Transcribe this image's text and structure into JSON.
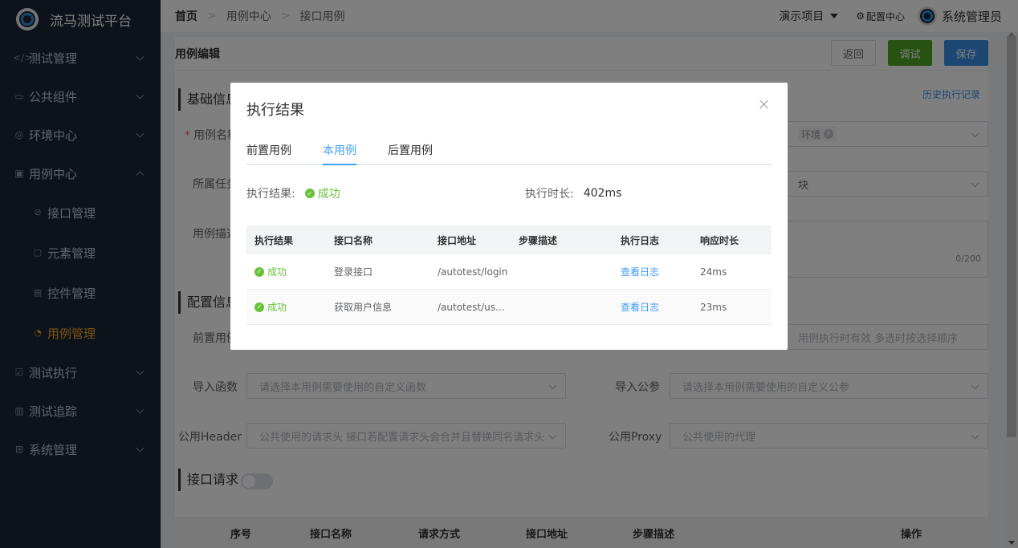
{
  "app": {
    "title": "流马测试平台"
  },
  "sidebar": {
    "items": [
      {
        "label": "测试管理",
        "icon": "code-icon"
      },
      {
        "label": "公共组件",
        "icon": "component-icon"
      },
      {
        "label": "环境中心",
        "icon": "globe-icon"
      },
      {
        "label": "用例中心",
        "icon": "case-icon"
      },
      {
        "label": "测试执行",
        "icon": "checkbox-icon"
      },
      {
        "label": "测试追踪",
        "icon": "chart-icon"
      },
      {
        "label": "系统管理",
        "icon": "grid-icon"
      }
    ],
    "sub_items": [
      {
        "label": "接口管理",
        "icon": "compass-icon"
      },
      {
        "label": "元素管理",
        "icon": "calendar-icon"
      },
      {
        "label": "控件管理",
        "icon": "widget-icon"
      },
      {
        "label": "用例管理",
        "icon": "gauge-icon"
      }
    ]
  },
  "topbar": {
    "breadcrumb": [
      "首页",
      "用例中心",
      "接口用例"
    ],
    "project": "演示项目",
    "config": "配置中心",
    "user": "系统管理员"
  },
  "page": {
    "title": "用例编辑",
    "back": "返回",
    "debug": "调试",
    "save": "保存",
    "history": "历史执行记录",
    "section_basic": "基础信息",
    "label_name": "用例名称",
    "label_module": "所属任务",
    "label_desc": "用例描述",
    "desc_count": "0/200",
    "env_tag": "环境",
    "module_tail": "块",
    "section_config": "配置信息",
    "label_pre": "前置用例",
    "pre_placeholder_tail": "用例执行时有效 多选时按选择顺序",
    "label_func": "导入函数",
    "func_placeholder": "请选择本用例需要使用的自定义函数",
    "label_param": "导入公参",
    "param_placeholder": "请选择本用例需要使用的自定义公参",
    "label_header": "公用Header",
    "header_placeholder": "公共使用的请求头 接口若配置请求头会合并且替换同名请求头",
    "label_proxy": "公用Proxy",
    "proxy_placeholder": "公共使用的代理",
    "section_request": "接口请求",
    "request_columns": [
      "序号",
      "接口名称",
      "请求方式",
      "接口地址",
      "步骤描述",
      "操作"
    ]
  },
  "modal": {
    "title": "执行结果",
    "tabs": [
      "前置用例",
      "本用例",
      "后置用例"
    ],
    "active_tab": 1,
    "result_label": "执行结果:",
    "result_value": "成功",
    "duration_label": "执行时长:",
    "duration_value": "402ms",
    "columns": [
      "执行结果",
      "接口名称",
      "接口地址",
      "步骤描述",
      "执行日志",
      "响应时长"
    ],
    "rows": [
      {
        "status": "成功",
        "name": "登录接口",
        "url": "/autotest/login",
        "desc": "",
        "log": "查看日志",
        "time": "24ms"
      },
      {
        "status": "成功",
        "name": "获取用户信息",
        "url": "/autotest/us…",
        "desc": "",
        "log": "查看日志",
        "time": "23ms"
      }
    ]
  },
  "colors": {
    "sidebar_bg": "#1d2434",
    "active": "#f5a623",
    "success": "#67c23a",
    "primary": "#409eff",
    "debug": "#4ea525"
  }
}
